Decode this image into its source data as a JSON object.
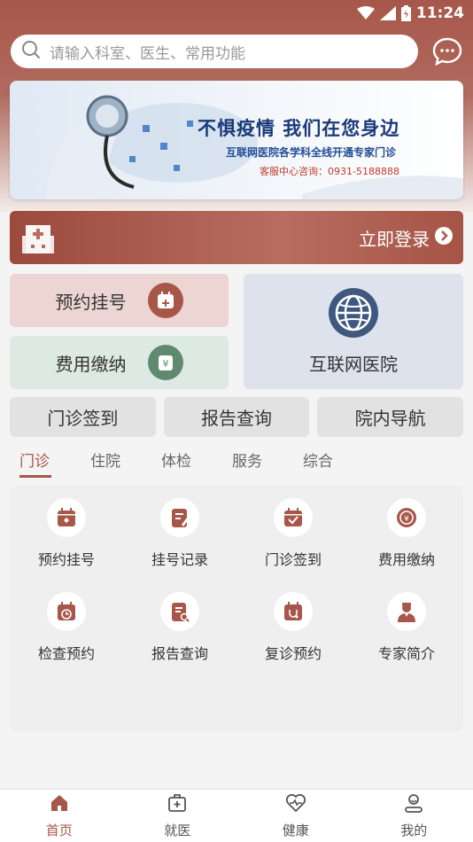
{
  "colors": {
    "brand": "#a7574a",
    "booking_bg": "#ecd5d2",
    "pay_bg": "#dde9e3",
    "net_bg": "#dde2ec",
    "pay_icon": "#5f8a6f",
    "net_icon": "#3f5880"
  },
  "status_bar": {
    "time": "11:24",
    "icons": [
      "wifi-icon",
      "signal-icon",
      "battery-icon"
    ]
  },
  "search": {
    "placeholder": "请输入科室、医生、常用功能",
    "icon": "search-icon"
  },
  "header": {
    "message_icon": "chat-bubble-icon"
  },
  "banner": {
    "title": "不惧疫情  我们在您身边",
    "subtitle": "互联网医院各学科全线开通专家门诊",
    "phone": "客服中心咨询：0931-5188888"
  },
  "login": {
    "label": "立即登录",
    "icon": "hospital-building-icon"
  },
  "cards": {
    "booking": {
      "label": "预约挂号",
      "icon": "calendar-plus-icon"
    },
    "payment": {
      "label": "费用缴纳",
      "icon": "yuan-wallet-icon"
    },
    "internet_hospital": {
      "label": "互联网医院",
      "icon": "globe-icon"
    }
  },
  "quick_buttons": [
    {
      "label": "门诊签到"
    },
    {
      "label": "报告查询"
    },
    {
      "label": "院内导航"
    }
  ],
  "tabs": [
    {
      "label": "门诊",
      "active": true
    },
    {
      "label": "住院",
      "active": false
    },
    {
      "label": "体检",
      "active": false
    },
    {
      "label": "服务",
      "active": false
    },
    {
      "label": "综合",
      "active": false
    }
  ],
  "grid_items": [
    {
      "label": "预约挂号",
      "icon": "calendar-icon"
    },
    {
      "label": "挂号记录",
      "icon": "document-pen-icon"
    },
    {
      "label": "门诊签到",
      "icon": "calendar-check-icon"
    },
    {
      "label": "费用缴纳",
      "icon": "yuan-coin-icon"
    },
    {
      "label": "检查预约",
      "icon": "calendar-clock-icon"
    },
    {
      "label": "报告查询",
      "icon": "report-search-icon"
    },
    {
      "label": "复诊预约",
      "icon": "stethoscope-calendar-icon"
    },
    {
      "label": "专家简介",
      "icon": "doctor-icon"
    }
  ],
  "bottom_nav": [
    {
      "label": "首页",
      "icon": "home-icon",
      "active": true
    },
    {
      "label": "就医",
      "icon": "medical-kit-icon",
      "active": false
    },
    {
      "label": "健康",
      "icon": "heart-pulse-icon",
      "active": false
    },
    {
      "label": "我的",
      "icon": "user-icon",
      "active": false
    }
  ]
}
